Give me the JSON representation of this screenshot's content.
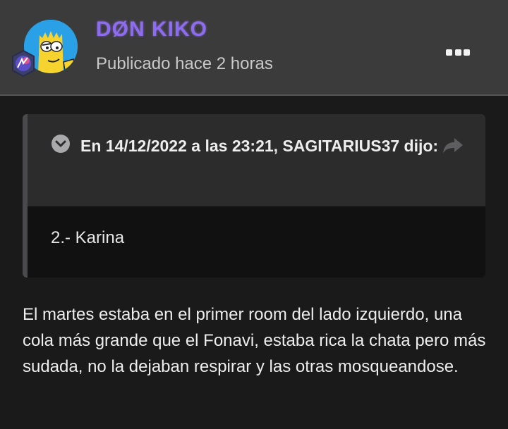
{
  "post": {
    "author": "DØN KIKO",
    "posted_time": "Publicado hace 2 horas"
  },
  "quote": {
    "attribution": "En 14/12/2022 a las 23:21, SAGITARIUS37 dijo:",
    "text": "2.- Karina"
  },
  "body": {
    "text": "El martes estaba en el primer room del lado izquierdo, una cola más grande que el Fonavi, estaba rica la chata pero más sudada, no la dejaban respirar y las otras mosqueandose."
  },
  "icons": {
    "avatar": "avatar-cartoon",
    "badge": "rank-badge-icon",
    "menu": "more-options-icon",
    "toggle": "chevron-down-icon",
    "share": "share-arrow-icon"
  },
  "colors": {
    "username": "#8e6cf0",
    "header_bg": "#3b3b3c",
    "page_bg": "#1a1a1b"
  }
}
